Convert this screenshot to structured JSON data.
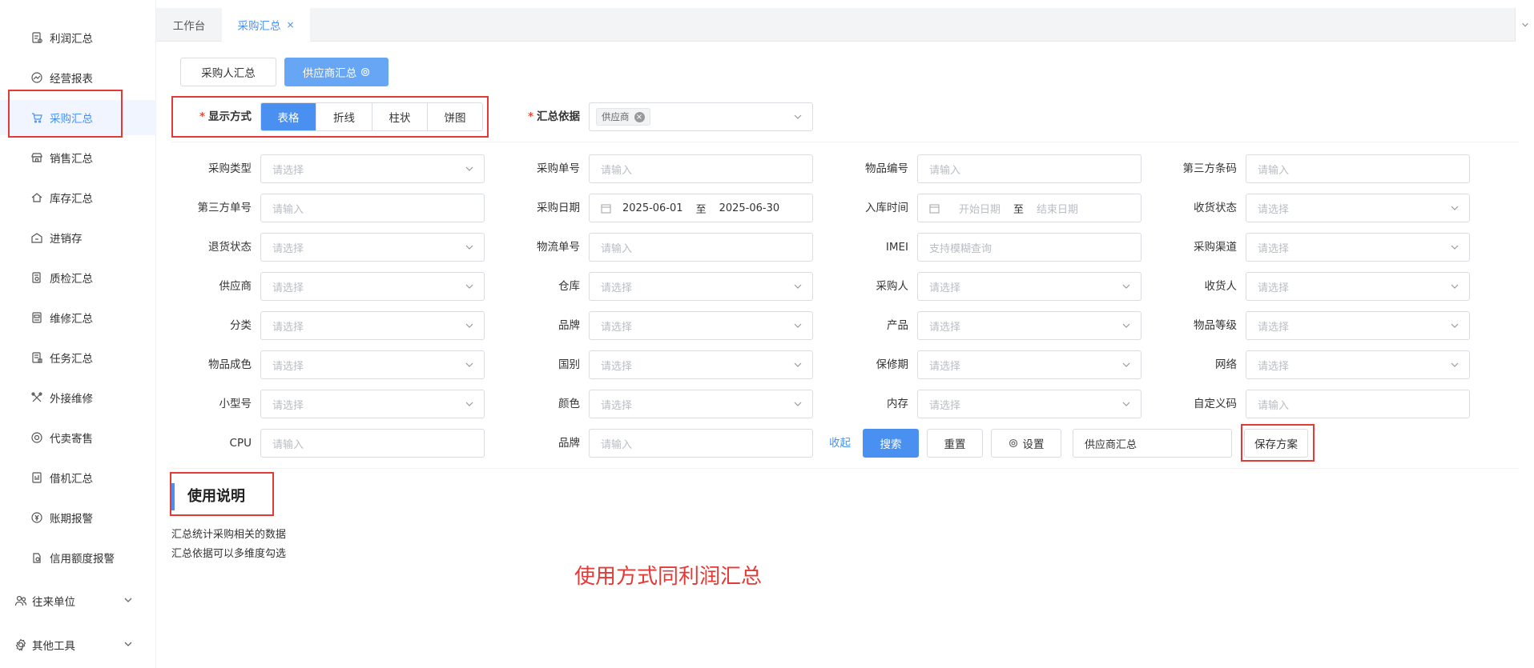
{
  "sidebar": {
    "items": [
      {
        "label": "利润汇总",
        "icon": "document-icon"
      },
      {
        "label": "经营报表",
        "icon": "chart-line-icon"
      },
      {
        "label": "采购汇总",
        "icon": "cart-icon",
        "active": true
      },
      {
        "label": "销售汇总",
        "icon": "store-icon"
      },
      {
        "label": "库存汇总",
        "icon": "home-icon"
      },
      {
        "label": "进销存",
        "icon": "warehouse-icon"
      },
      {
        "label": "质检汇总",
        "icon": "inspection-icon"
      },
      {
        "label": "维修汇总",
        "icon": "repair-report-icon"
      },
      {
        "label": "任务汇总",
        "icon": "task-icon"
      },
      {
        "label": "外接维修",
        "icon": "tools-icon"
      },
      {
        "label": "代卖寄售",
        "icon": "consign-icon"
      },
      {
        "label": "借机汇总",
        "icon": "device-icon"
      },
      {
        "label": "账期报警",
        "icon": "yen-icon"
      },
      {
        "label": "信用额度报警",
        "icon": "credit-icon"
      }
    ],
    "groups": [
      {
        "label": "往来单位",
        "icon": "users-icon"
      },
      {
        "label": "其他工具",
        "icon": "gear-icon"
      }
    ]
  },
  "tabs": [
    {
      "label": "工作台"
    },
    {
      "label": "采购汇总",
      "close": "×"
    }
  ],
  "subtabs": {
    "buyer": "采购人汇总",
    "supplier": "供应商汇总"
  },
  "display": {
    "label": "显示方式",
    "required_mark": "*",
    "options": [
      "表格",
      "折线",
      "柱状",
      "饼图"
    ],
    "active": "表格"
  },
  "basis": {
    "label": "汇总依据",
    "required_mark": "*",
    "tag": "供应商"
  },
  "filters": {
    "purchase_type": {
      "label": "采购类型",
      "placeholder": "请选择"
    },
    "purchase_no": {
      "label": "采购单号",
      "placeholder": "请输入"
    },
    "item_no": {
      "label": "物品编号",
      "placeholder": "请输入"
    },
    "third_barcode": {
      "label": "第三方条码",
      "placeholder": "请输入"
    },
    "third_order": {
      "label": "第三方单号",
      "placeholder": "请输入"
    },
    "purchase_date": {
      "label": "采购日期",
      "start": "2025-06-01",
      "sep": "至",
      "end": "2025-06-30"
    },
    "inbound_time": {
      "label": "入库时间",
      "start": "开始日期",
      "sep": "至",
      "end": "结束日期"
    },
    "receive_status": {
      "label": "收货状态",
      "placeholder": "请选择"
    },
    "return_status": {
      "label": "退货状态",
      "placeholder": "请选择"
    },
    "logistics_no": {
      "label": "物流单号",
      "placeholder": "请输入"
    },
    "imei": {
      "label": "IMEI",
      "placeholder": "支持模糊查询"
    },
    "channel": {
      "label": "采购渠道",
      "placeholder": "请选择"
    },
    "supplier": {
      "label": "供应商",
      "placeholder": "请选择"
    },
    "warehouse": {
      "label": "仓库",
      "placeholder": "请选择"
    },
    "buyer": {
      "label": "采购人",
      "placeholder": "请选择"
    },
    "receiver": {
      "label": "收货人",
      "placeholder": "请选择"
    },
    "category": {
      "label": "分类",
      "placeholder": "请选择"
    },
    "brand": {
      "label": "品牌",
      "placeholder": "请选择"
    },
    "product": {
      "label": "产品",
      "placeholder": "请选择"
    },
    "grade": {
      "label": "物品等级",
      "placeholder": "请选择"
    },
    "condition": {
      "label": "物品成色",
      "placeholder": "请选择"
    },
    "country": {
      "label": "国别",
      "placeholder": "请选择"
    },
    "warranty": {
      "label": "保修期",
      "placeholder": "请选择"
    },
    "network": {
      "label": "网络",
      "placeholder": "请选择"
    },
    "model": {
      "label": "小型号",
      "placeholder": "请选择"
    },
    "color": {
      "label": "颜色",
      "placeholder": "请选择"
    },
    "memory": {
      "label": "内存",
      "placeholder": "请选择"
    },
    "custom_code": {
      "label": "自定义码",
      "placeholder": "请输入"
    },
    "cpu": {
      "label": "CPU",
      "placeholder": "请输入"
    },
    "brand2": {
      "label": "品牌",
      "placeholder": "请输入"
    }
  },
  "actions": {
    "collapse": "收起",
    "search": "搜索",
    "reset": "重置",
    "settings": "设置",
    "scheme_value": "供应商汇总",
    "save_scheme": "保存方案"
  },
  "instructions": {
    "title": "使用说明",
    "lines": [
      "汇总统计采购相关的数据",
      "汇总依据可以多维度勾选"
    ]
  },
  "annotation": "使用方式同利润汇总",
  "colors": {
    "primary": "#4a90f0",
    "highlight": "#e53935"
  }
}
